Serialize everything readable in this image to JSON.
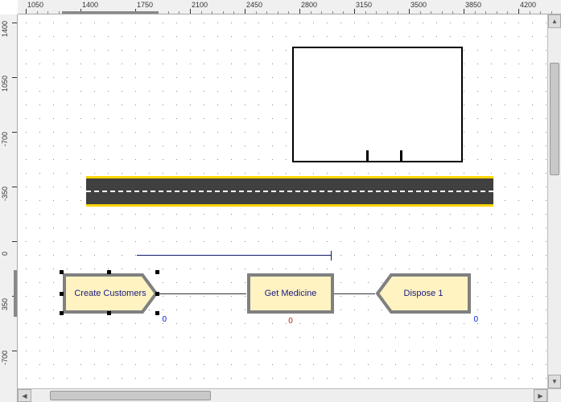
{
  "ruler_h": [
    "1050",
    "1400",
    "1750",
    "2100",
    "2450",
    "2800",
    "3150",
    "3500",
    "3850",
    "4200"
  ],
  "ruler_v": [
    "1400",
    "1050",
    "-700",
    "-350",
    "0",
    "350",
    "-700"
  ],
  "nodes": {
    "create": {
      "label": "Create Customers",
      "count": "0"
    },
    "process": {
      "label": "Get Medicine",
      "count": "0"
    },
    "dispose": {
      "label": "Dispose 1",
      "count": "0"
    }
  }
}
